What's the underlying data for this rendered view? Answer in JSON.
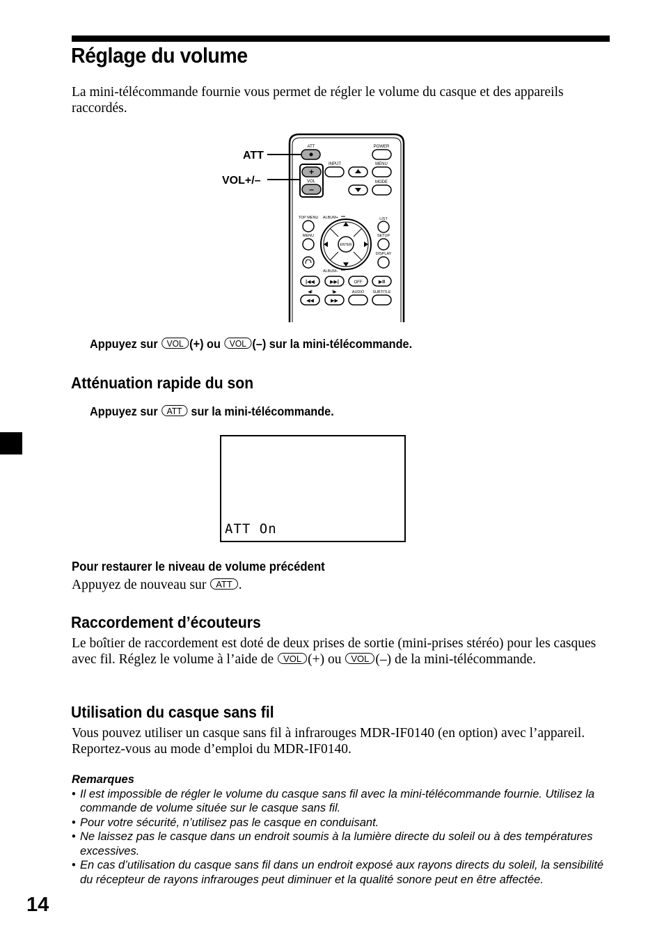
{
  "page": {
    "title": "Réglage du volume",
    "intro": "La mini-télécommande fournie vous permet de régler le volume du casque et des appareils raccordés.",
    "page_number": "14"
  },
  "remote": {
    "callouts": {
      "att": "ATT",
      "vol": "VOL+/–"
    },
    "labels": {
      "att": "ATT",
      "power": "POWER",
      "input": "INPUT",
      "menu_top": "MENU",
      "vol": "VOL",
      "mode": "MODE",
      "top_menu": "TOP MENU",
      "album_plus": "ALBUM+",
      "list": "LIST",
      "menu": "MENU",
      "setup": "SETUP",
      "display": "DISPLAY",
      "enter": "ENTER",
      "album_minus": "ALBUM–",
      "off": "OFF",
      "audio": "AUDIO",
      "subtitle": "SUBTITLE",
      "vol_plus": "+",
      "vol_minus": "–"
    }
  },
  "volume_instruction": {
    "prefix": "Appuyez sur",
    "key1": "VOL",
    "mid": "(+) ou",
    "key2": "VOL",
    "suffix": "(–) sur la mini-télécommande."
  },
  "attenuation": {
    "heading": "Atténuation rapide du son",
    "instruction_prefix": "Appuyez sur",
    "instruction_key": "ATT",
    "instruction_suffix": "sur la mini-télécommande.",
    "display_text": "ATT On",
    "restore_heading": "Pour restaurer le niveau de volume précédent",
    "restore_prefix": "Appuyez de nouveau sur",
    "restore_key": "ATT",
    "restore_suffix": "."
  },
  "headphones": {
    "heading": "Raccordement d’écouteurs",
    "text_part1": "Le boîtier de raccordement est doté de deux prises de sortie (mini-prises stéréo) pour les casques avec fil. Réglez le volume à l’aide de",
    "key1": "VOL",
    "text_part2": "(+) ou",
    "key2": "VOL",
    "text_part3": "(–) de la mini-télécommande."
  },
  "wireless": {
    "heading": "Utilisation du casque sans fil",
    "text": "Vous pouvez utiliser un casque sans fil à infrarouges MDR-IF0140 (en option) avec l’appareil. Reportez-vous au mode d’emploi du MDR-IF0140."
  },
  "notes": {
    "title": "Remarques",
    "items": [
      "Il est impossible de régler le volume du casque sans fil avec la mini-télécommande fournie. Utilisez la commande de volume située sur le casque sans fil.",
      "Pour votre sécurité, n’utilisez pas le casque en conduisant.",
      "Ne laissez pas le casque dans un endroit soumis à la lumière directe du soleil ou à des températures excessives.",
      "En cas d’utilisation du casque sans fil dans un endroit exposé aux rayons directs du soleil, la sensibilité du récepteur de rayons infrarouges peut diminuer et la qualité sonore peut en être affectée."
    ]
  }
}
